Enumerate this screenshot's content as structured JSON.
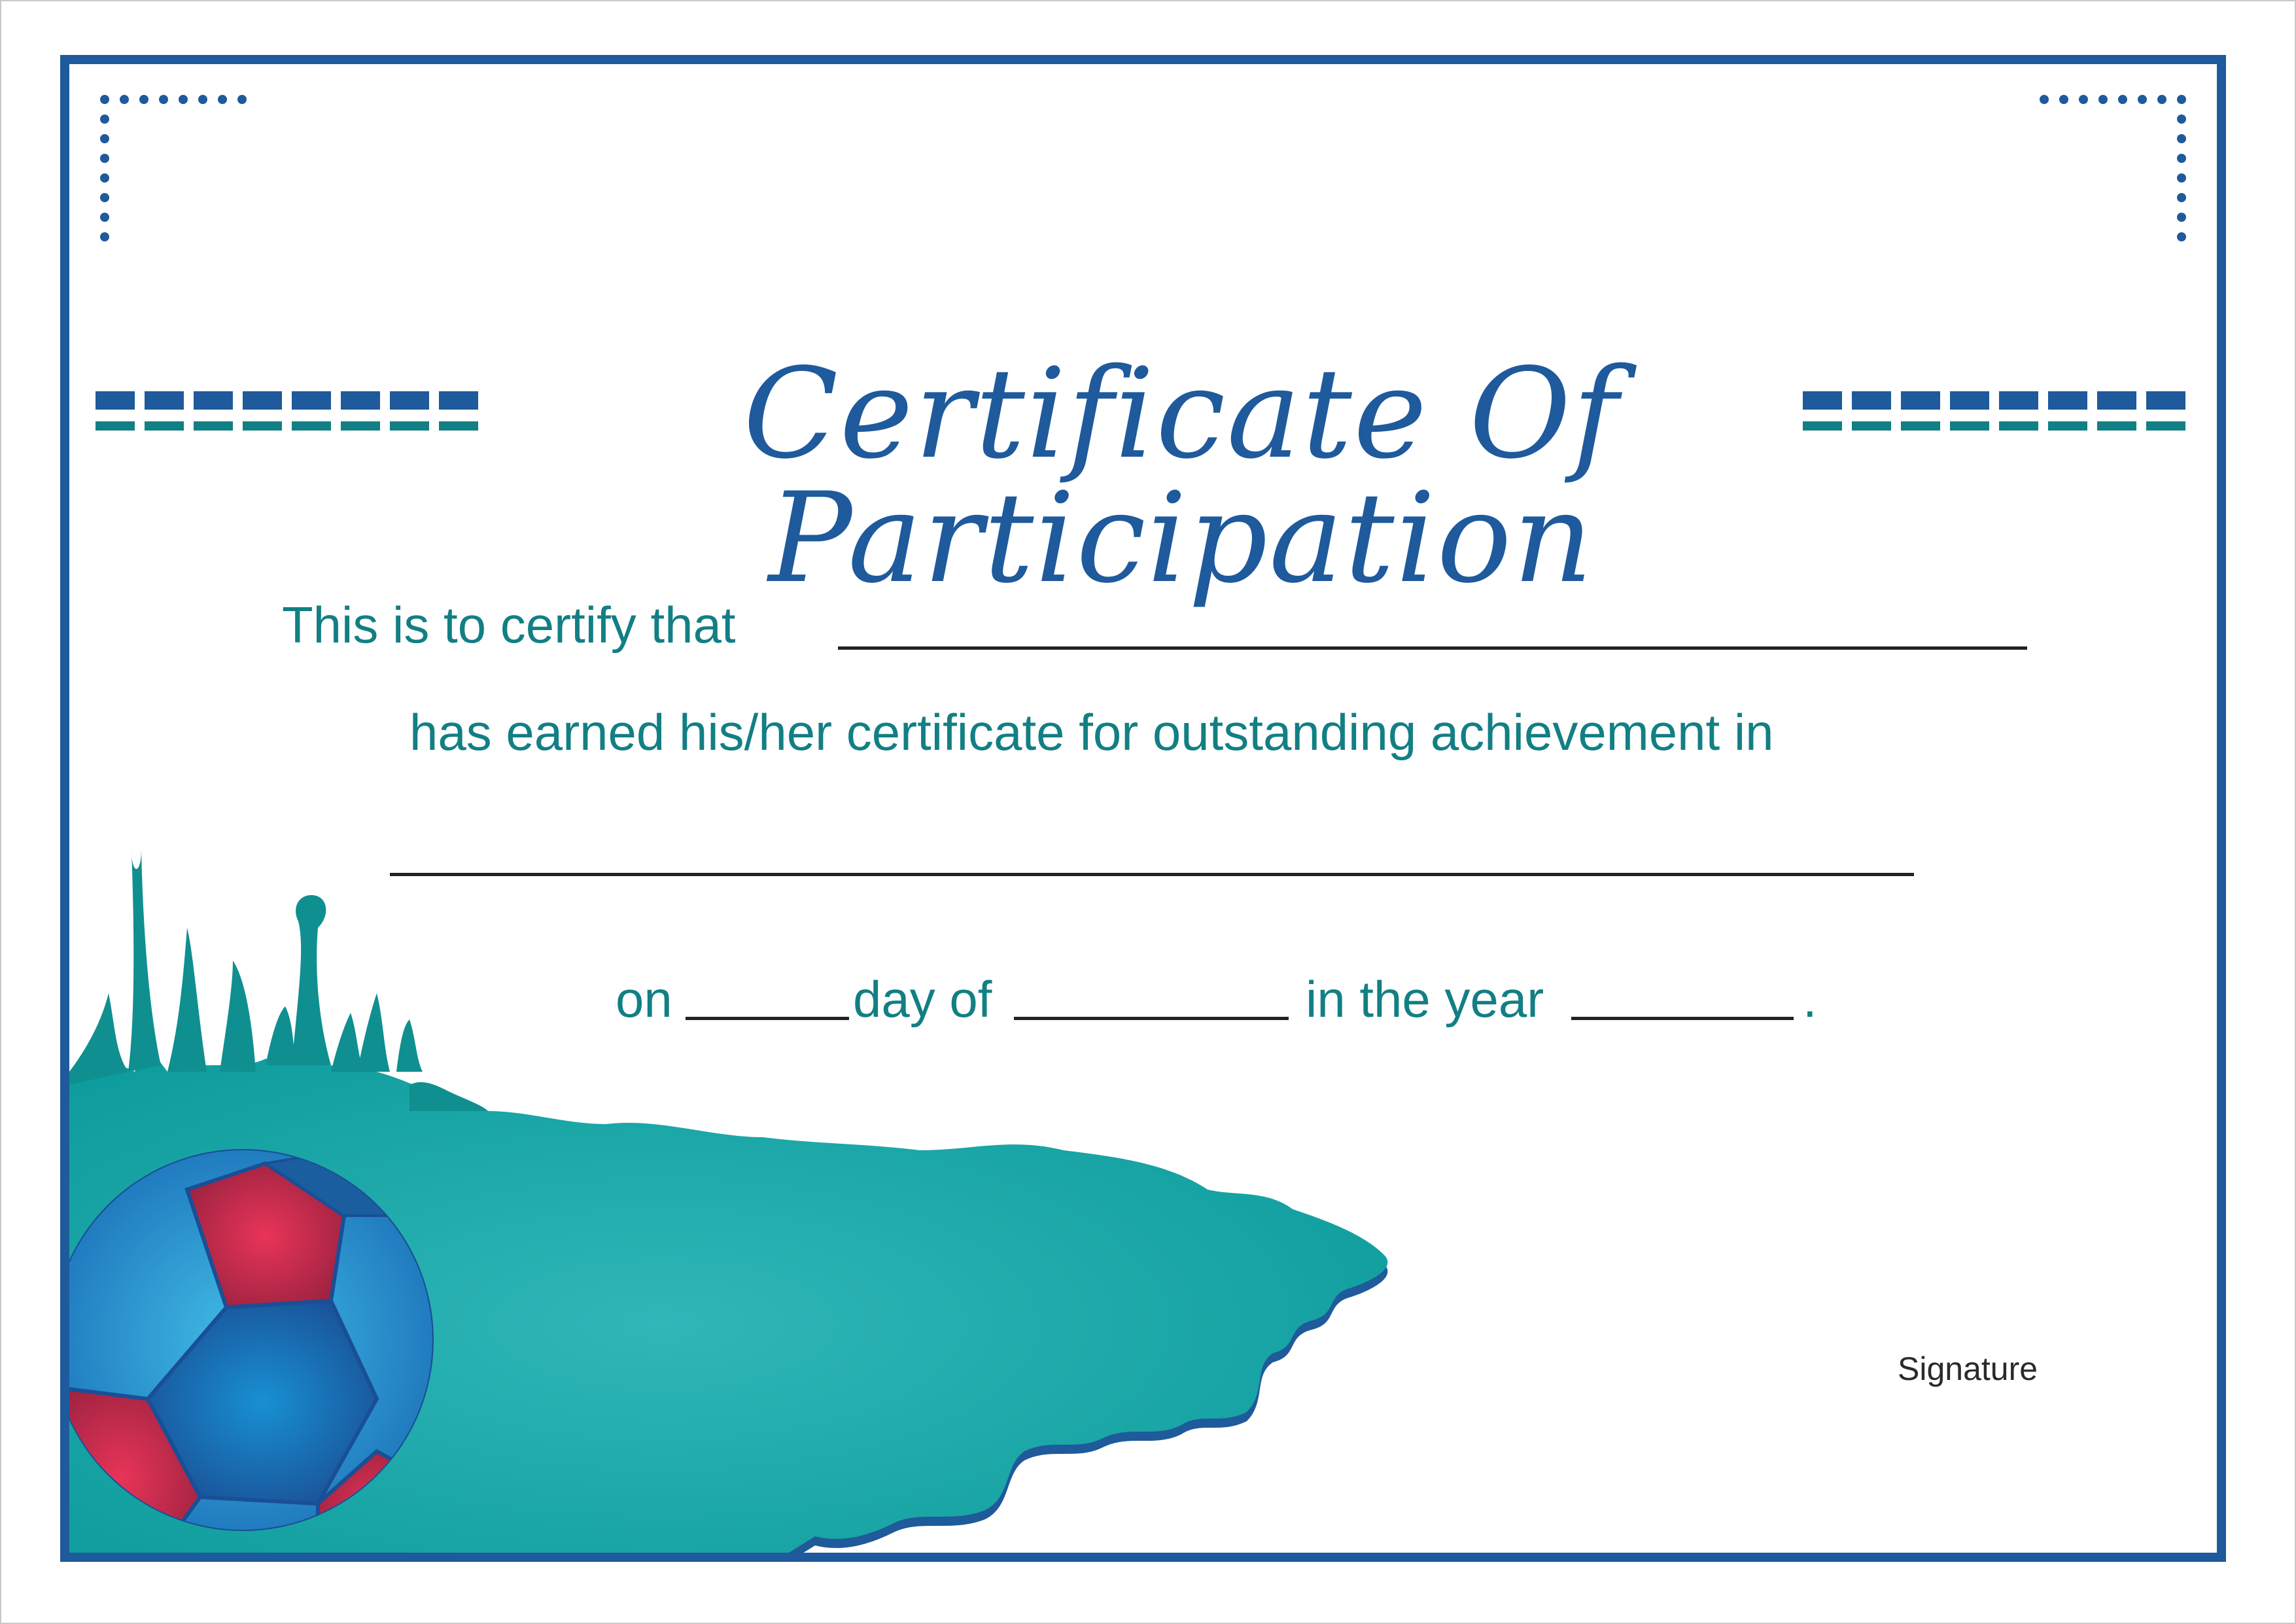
{
  "certificate": {
    "title": "Certificate Of Participation",
    "line1": "This is to certify that",
    "line2": "has earned his/her certificate for outstanding achievement in",
    "date_on": "on",
    "date_day_of": "day of",
    "date_in_year": "in the year",
    "date_end": ".",
    "signature_label": "Signature"
  },
  "colors": {
    "frame": "#1e5a9c",
    "text_teal": "#127f84",
    "splash_teal": "#1aa3a6",
    "ball_blue": "#1f86c9",
    "ball_red": "#c8284b"
  }
}
